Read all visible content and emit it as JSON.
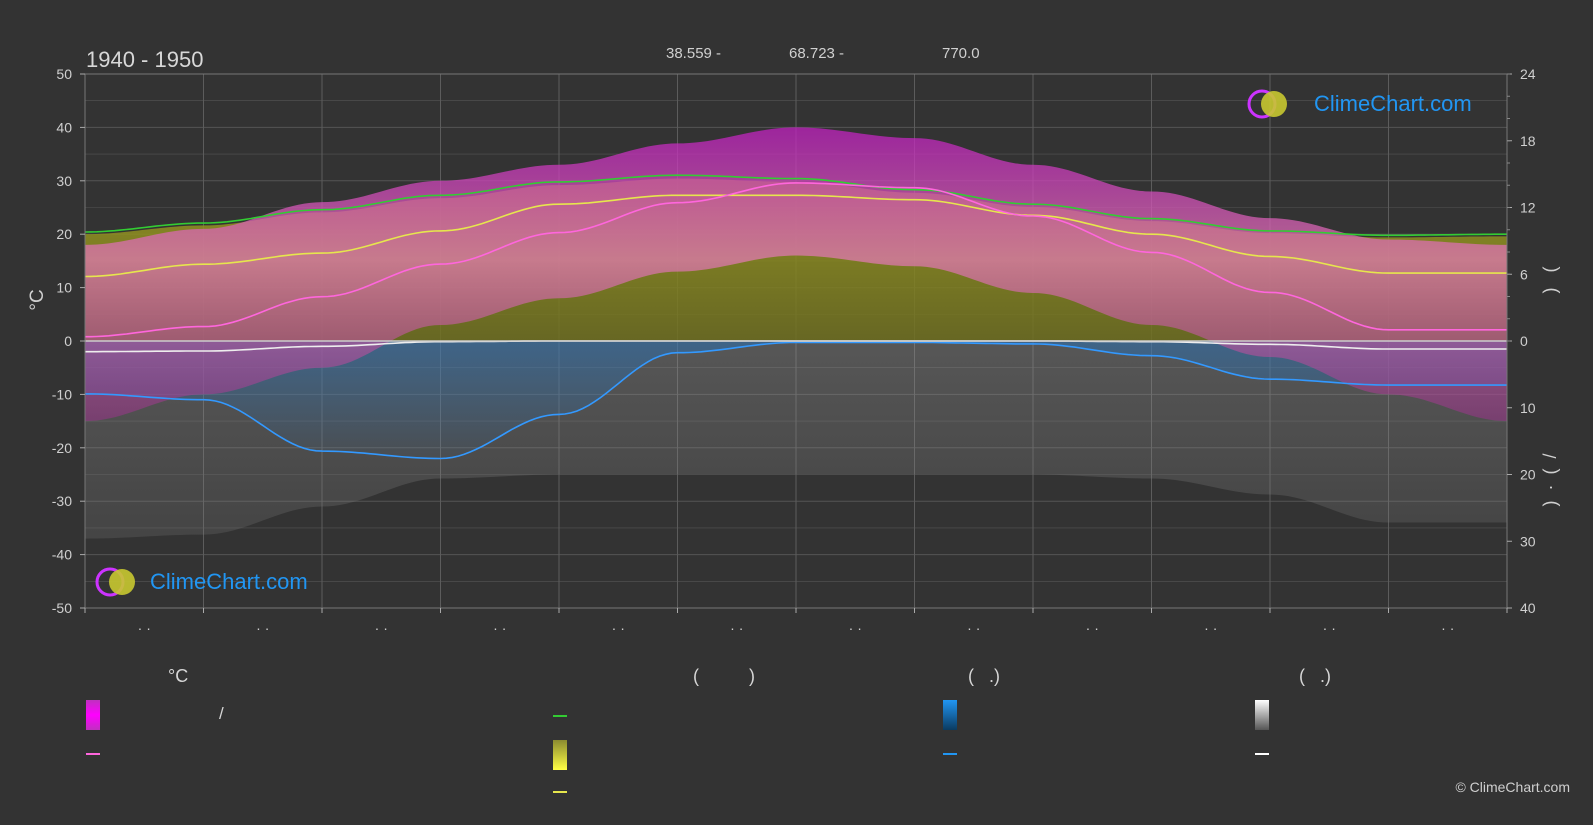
{
  "header": {
    "period": "1940 - 1950",
    "lat": "38.559 -",
    "lon": "68.723 -",
    "elev": "770.0"
  },
  "chart_data": {
    "type": "area",
    "left_axis": {
      "label": "°C",
      "min": -50,
      "max": 50,
      "ticks": [
        50,
        40,
        30,
        20,
        10,
        0,
        -10,
        -20,
        -30,
        -40,
        -50
      ]
    },
    "right_axis": {
      "label_top": ")   (",
      "label_bottom": ")  ·  (  /",
      "ticks_top": [
        24,
        18,
        12,
        6,
        0
      ],
      "ticks_bottom": [
        10,
        20,
        30,
        40
      ]
    },
    "x_ticks": [
      "· ·",
      "· ·",
      "· ·",
      "· ·",
      "· ·",
      "· ·",
      "· ·",
      "· ·",
      "· ·",
      "· ·",
      "· ·",
      "· ·"
    ],
    "month_positions": [
      0,
      1,
      2,
      3,
      4,
      5,
      6,
      7,
      8,
      9,
      10,
      11,
      12
    ],
    "series": [
      {
        "key": "daylight",
        "unit": "h",
        "color": "#33cc33",
        "values": [
          9.8,
          10.6,
          11.8,
          13.1,
          14.3,
          14.9,
          14.6,
          13.6,
          12.3,
          11.0,
          9.9,
          9.5,
          9.6
        ]
      },
      {
        "key": "sunshine",
        "unit": "h",
        "color": "#e6e64d",
        "values": [
          5.8,
          6.9,
          7.9,
          9.9,
          12.3,
          13.1,
          13.1,
          12.7,
          11.3,
          9.6,
          7.6,
          6.1,
          6.1
        ]
      },
      {
        "key": "temp_mean",
        "unit": "°C",
        "color": "#ff66dd",
        "values": [
          0.8,
          2.7,
          8.3,
          14.4,
          20.3,
          25.9,
          29.6,
          28.7,
          23.4,
          16.6,
          9.1,
          2.1,
          2.1
        ]
      },
      {
        "key": "precip",
        "unit": "mm",
        "color": "#3399ff",
        "values": [
          3.6,
          4.0,
          7.5,
          8.0,
          5.0,
          0.8,
          0.1,
          0.1,
          0.2,
          1.0,
          2.6,
          3.0,
          3.0
        ]
      },
      {
        "key": "snow",
        "unit": "mm",
        "color": "#eeeeee",
        "values": [
          1.6,
          1.5,
          0.8,
          0.1,
          0.0,
          0.0,
          0.0,
          0.0,
          0.0,
          0.1,
          0.5,
          1.2,
          1.2
        ]
      }
    ],
    "bands": {
      "temp_max": [
        18,
        21,
        26,
        30,
        33,
        37,
        40,
        38,
        33,
        28,
        23,
        19,
        18
      ],
      "temp_min": [
        -15,
        -10,
        -5,
        3,
        8,
        13,
        16,
        14,
        9,
        3,
        -3,
        -10,
        -15
      ]
    },
    "grid": true
  },
  "legend": {
    "col1_head": "°C",
    "col2_head": "(          )",
    "col3_head": "(   .)",
    "col4_head": "(   .)",
    "slash": "/"
  },
  "brand": {
    "name": "ClimeChart.com",
    "copyright": "© ClimeChart.com",
    "color": "#2196f3"
  }
}
